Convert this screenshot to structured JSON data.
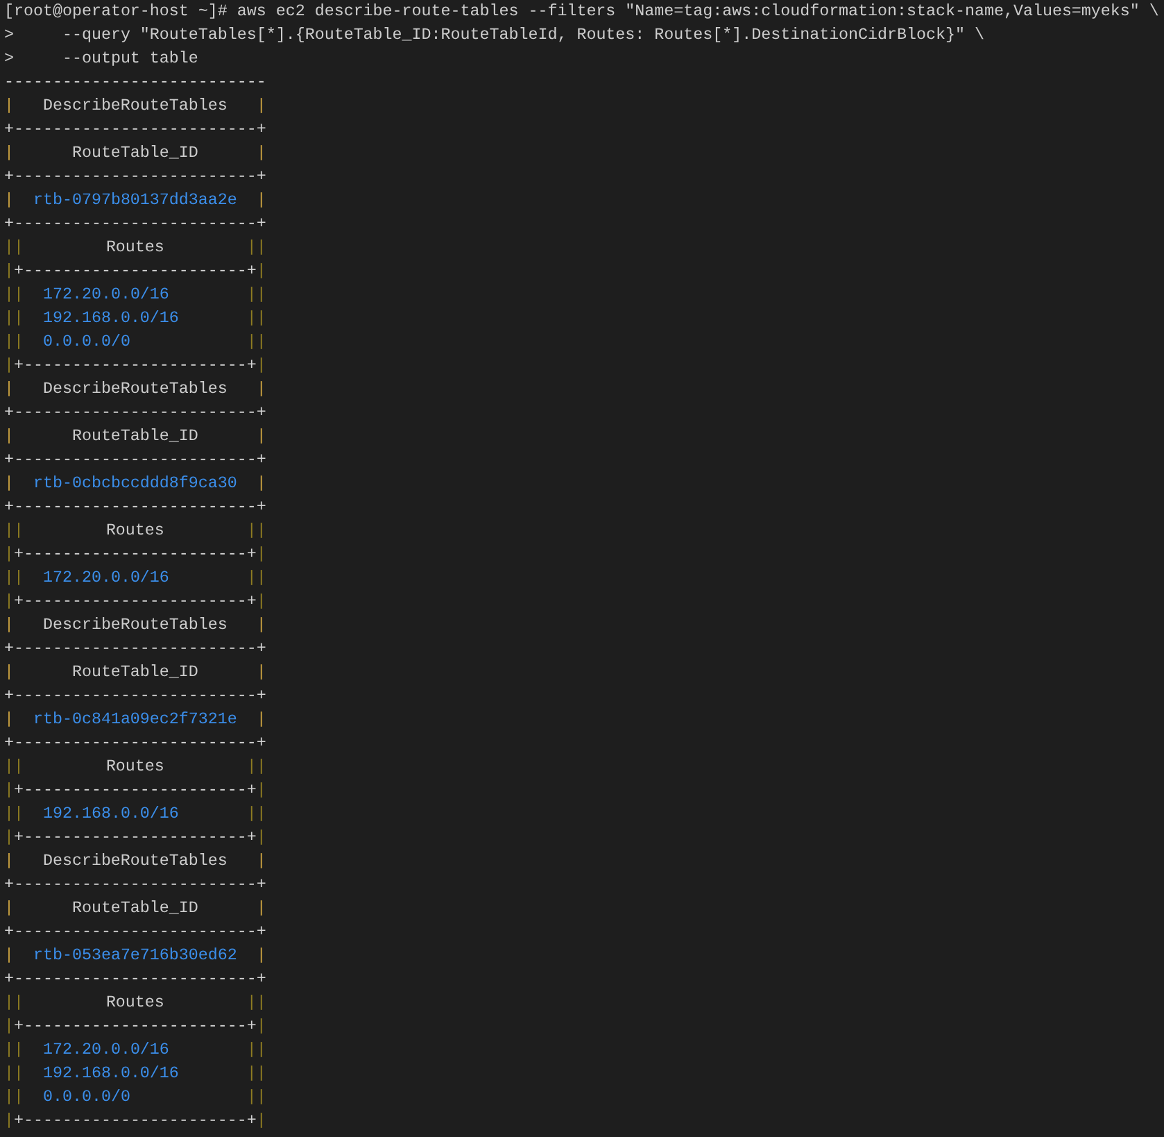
{
  "lines": [
    {
      "kind": "command",
      "prompt": "[root@operator-host ~]#",
      "text": "aws ec2 describe-route-tables --filters \"Name=tag:aws:cloudformation:stack-name,Values=myeks\" \\"
    },
    {
      "kind": "continuation",
      "prompt": ">",
      "text": "--query \"RouteTables[*].{RouteTable_ID:RouteTableId, Routes: Routes[*].DestinationCidrBlock}\" \\"
    },
    {
      "kind": "continuation",
      "prompt": ">",
      "text": "--output table"
    },
    {
      "kind": "rule",
      "text": "---------------------------"
    },
    {
      "kind": "heading",
      "border": {
        "kind": "outer",
        "left": "|",
        "right": "|"
      },
      "text": "DescribeRouteTables"
    },
    {
      "kind": "rule",
      "text": "+-------------------------+"
    },
    {
      "kind": "heading",
      "border": {
        "kind": "outer",
        "left": "|",
        "right": "|"
      },
      "text": "RouteTable_ID"
    },
    {
      "kind": "rule",
      "text": "+-------------------------+"
    },
    {
      "kind": "value",
      "border": {
        "kind": "outer",
        "left": "|",
        "right": "|"
      },
      "text": "rtb-0797b80137dd3aa2e"
    },
    {
      "kind": "rule",
      "text": "+-------------------------+"
    },
    {
      "kind": "heading",
      "border": {
        "kind": "inner",
        "left": "||",
        "right": "||"
      },
      "text": "Routes"
    },
    {
      "kind": "rule",
      "border": {
        "kind": "inner",
        "left": "|",
        "right": "|"
      },
      "text": "+-----------------------+"
    },
    {
      "kind": "value",
      "border": {
        "kind": "inner",
        "left": "||",
        "right": "||"
      },
      "text": "172.20.0.0/16"
    },
    {
      "kind": "value",
      "border": {
        "kind": "inner",
        "left": "||",
        "right": "||"
      },
      "text": "192.168.0.0/16"
    },
    {
      "kind": "value",
      "border": {
        "kind": "inner",
        "left": "||",
        "right": "||"
      },
      "text": "0.0.0.0/0"
    },
    {
      "kind": "rule",
      "border": {
        "kind": "inner",
        "left": "|",
        "right": "|"
      },
      "text": "+-----------------------+"
    },
    {
      "kind": "heading",
      "border": {
        "kind": "outer",
        "left": "|",
        "right": "|"
      },
      "text": "DescribeRouteTables"
    },
    {
      "kind": "rule",
      "text": "+-------------------------+"
    },
    {
      "kind": "heading",
      "border": {
        "kind": "outer",
        "left": "|",
        "right": "|"
      },
      "text": "RouteTable_ID"
    },
    {
      "kind": "rule",
      "text": "+-------------------------+"
    },
    {
      "kind": "value",
      "border": {
        "kind": "outer",
        "left": "|",
        "right": "|"
      },
      "text": "rtb-0cbcbccddd8f9ca30"
    },
    {
      "kind": "rule",
      "text": "+-------------------------+"
    },
    {
      "kind": "heading",
      "border": {
        "kind": "inner",
        "left": "||",
        "right": "||"
      },
      "text": "Routes"
    },
    {
      "kind": "rule",
      "border": {
        "kind": "inner",
        "left": "|",
        "right": "|"
      },
      "text": "+-----------------------+"
    },
    {
      "kind": "value",
      "border": {
        "kind": "inner",
        "left": "||",
        "right": "||"
      },
      "text": "172.20.0.0/16"
    },
    {
      "kind": "rule",
      "border": {
        "kind": "inner",
        "left": "|",
        "right": "|"
      },
      "text": "+-----------------------+"
    },
    {
      "kind": "heading",
      "border": {
        "kind": "outer",
        "left": "|",
        "right": "|"
      },
      "text": "DescribeRouteTables"
    },
    {
      "kind": "rule",
      "text": "+-------------------------+"
    },
    {
      "kind": "heading",
      "border": {
        "kind": "outer",
        "left": "|",
        "right": "|"
      },
      "text": "RouteTable_ID"
    },
    {
      "kind": "rule",
      "text": "+-------------------------+"
    },
    {
      "kind": "value",
      "border": {
        "kind": "outer",
        "left": "|",
        "right": "|"
      },
      "text": "rtb-0c841a09ec2f7321e"
    },
    {
      "kind": "rule",
      "text": "+-------------------------+"
    },
    {
      "kind": "heading",
      "border": {
        "kind": "inner",
        "left": "||",
        "right": "||"
      },
      "text": "Routes"
    },
    {
      "kind": "rule",
      "border": {
        "kind": "inner",
        "left": "|",
        "right": "|"
      },
      "text": "+-----------------------+"
    },
    {
      "kind": "value",
      "border": {
        "kind": "inner",
        "left": "||",
        "right": "||"
      },
      "text": "192.168.0.0/16"
    },
    {
      "kind": "rule",
      "border": {
        "kind": "inner",
        "left": "|",
        "right": "|"
      },
      "text": "+-----------------------+"
    },
    {
      "kind": "heading",
      "border": {
        "kind": "outer",
        "left": "|",
        "right": "|"
      },
      "text": "DescribeRouteTables"
    },
    {
      "kind": "rule",
      "text": "+-------------------------+"
    },
    {
      "kind": "heading",
      "border": {
        "kind": "outer",
        "left": "|",
        "right": "|"
      },
      "text": "RouteTable_ID"
    },
    {
      "kind": "rule",
      "text": "+-------------------------+"
    },
    {
      "kind": "value",
      "border": {
        "kind": "outer",
        "left": "|",
        "right": "|"
      },
      "text": "rtb-053ea7e716b30ed62"
    },
    {
      "kind": "rule",
      "text": "+-------------------------+"
    },
    {
      "kind": "heading",
      "border": {
        "kind": "inner",
        "left": "||",
        "right": "||"
      },
      "text": "Routes"
    },
    {
      "kind": "rule",
      "border": {
        "kind": "inner",
        "left": "|",
        "right": "|"
      },
      "text": "+-----------------------+"
    },
    {
      "kind": "value",
      "border": {
        "kind": "inner",
        "left": "||",
        "right": "||"
      },
      "text": "172.20.0.0/16"
    },
    {
      "kind": "value",
      "border": {
        "kind": "inner",
        "left": "||",
        "right": "||"
      },
      "text": "192.168.0.0/16"
    },
    {
      "kind": "value",
      "border": {
        "kind": "inner",
        "left": "||",
        "right": "||"
      },
      "text": "0.0.0.0/0"
    },
    {
      "kind": "rule",
      "border": {
        "kind": "inner",
        "left": "|",
        "right": "|"
      },
      "text": "+-----------------------+"
    }
  ]
}
